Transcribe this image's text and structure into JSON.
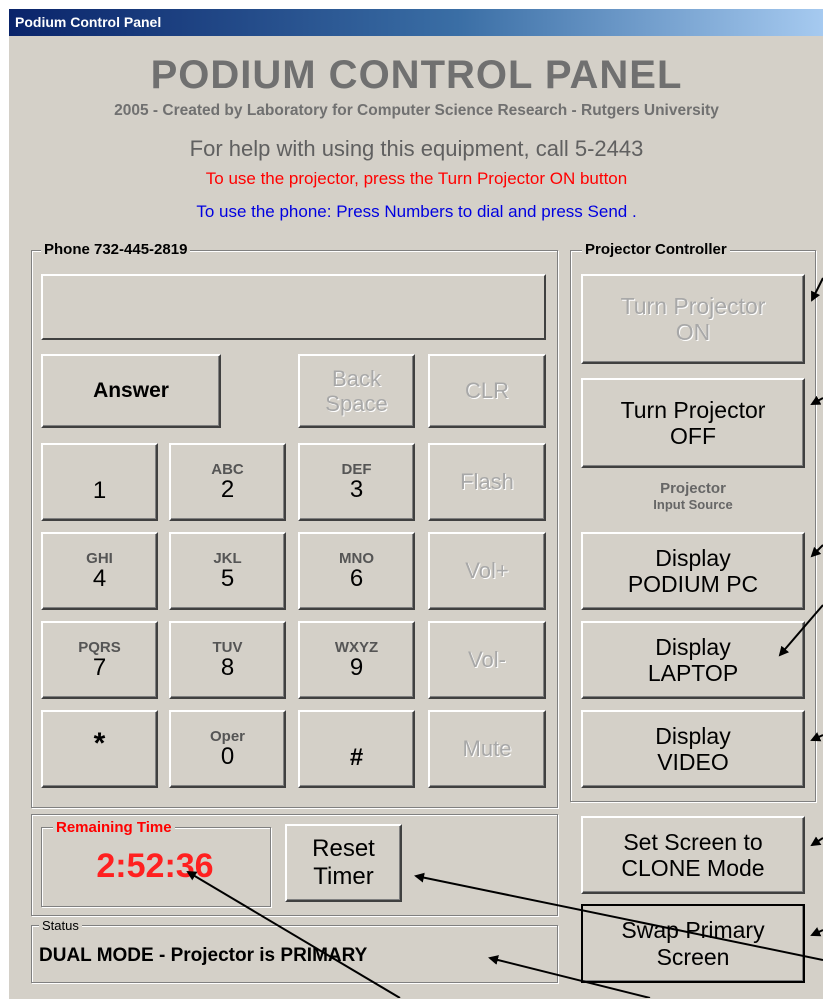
{
  "window": {
    "title": "Podium Control Panel"
  },
  "header": {
    "title": "PODIUM CONTROL PANEL",
    "credit": "2005 - Created by Laboratory for Computer Science Research - Rutgers University",
    "help": "For help with using this equipment, call 5-2443",
    "projector_note": "To use the projector, press  the Turn Projector ON button",
    "phone_note": "To use the phone:  Press Numbers to dial and press Send ."
  },
  "phone": {
    "legend": "Phone  732-445-2819",
    "dial_display": "",
    "answer": "Answer",
    "backspace": [
      "Back",
      "Space"
    ],
    "clear": "CLR",
    "flash": "Flash",
    "vol_up": "Vol+",
    "vol_down": "Vol-",
    "mute": "Mute",
    "keys": [
      {
        "letters": "",
        "digit": "1"
      },
      {
        "letters": "ABC",
        "digit": "2"
      },
      {
        "letters": "DEF",
        "digit": "3"
      },
      {
        "letters": "GHI",
        "digit": "4"
      },
      {
        "letters": "JKL",
        "digit": "5"
      },
      {
        "letters": "MNO",
        "digit": "6"
      },
      {
        "letters": "PQRS",
        "digit": "7"
      },
      {
        "letters": "TUV",
        "digit": "8"
      },
      {
        "letters": "WXYZ",
        "digit": "9"
      },
      {
        "letters": "",
        "digit": "*"
      },
      {
        "letters": "Oper",
        "digit": "0"
      },
      {
        "letters": "",
        "digit": "#"
      }
    ]
  },
  "projector": {
    "legend": "Projector Controller",
    "on": [
      "Turn Projector",
      "ON"
    ],
    "off": [
      "Turn Projector",
      "OFF"
    ],
    "input_source_label": [
      "Projector",
      "Input Source"
    ],
    "display_pc": [
      "Display",
      "PODIUM PC"
    ],
    "display_laptop": [
      "Display",
      "LAPTOP"
    ],
    "display_video": [
      "Display",
      "VIDEO"
    ]
  },
  "screen": {
    "clone": [
      "Set Screen to",
      "CLONE Mode"
    ],
    "swap": [
      "Swap Primary",
      "Screen"
    ]
  },
  "timer": {
    "legend": "Remaining Time",
    "value": "2:52:36",
    "reset": [
      "Reset",
      "Timer"
    ]
  },
  "status": {
    "legend": "Status",
    "value": "DUAL MODE - Projector is PRIMARY"
  },
  "colors": {
    "panel_bg": "#d4d0c8",
    "title_bar": "#0a246a",
    "projector_note": "#ff0000",
    "phone_note": "#0000e0",
    "timer": "#ff2020"
  }
}
